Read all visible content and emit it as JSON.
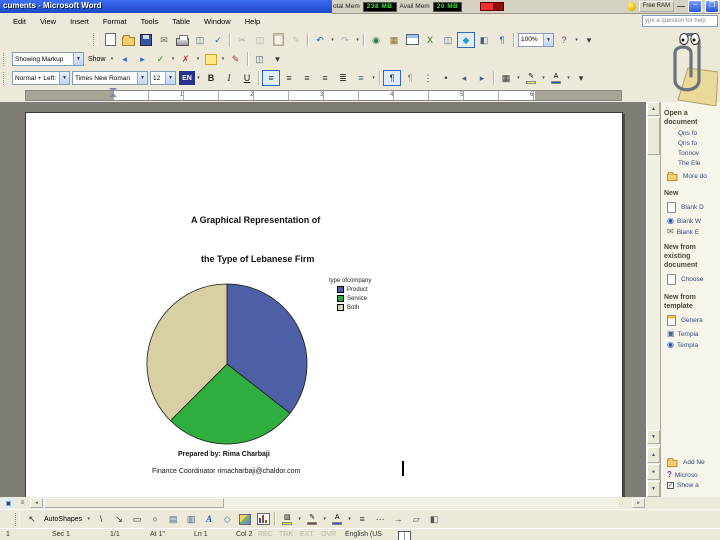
{
  "window": {
    "title_visible": "cuments - Microsoft Word"
  },
  "ram_widget": {
    "total_label": "otal Mem",
    "total_value": "238 MB",
    "avail_label": "Avail Mem",
    "avail_value": "20 MB",
    "free_button": "Free RAM",
    "minimize_glyph": "—"
  },
  "menubar": {
    "items": [
      "Edit",
      "View",
      "Insert",
      "Format",
      "Tools",
      "Table",
      "Window",
      "Help"
    ],
    "ask_box": "ype a question for help"
  },
  "toolbars": {
    "standard": [
      {
        "name": "new-document",
        "shape": "page"
      },
      {
        "name": "open",
        "shape": "folder"
      },
      {
        "name": "save",
        "shape": "disk"
      },
      {
        "name": "mail-recipient",
        "glyph": "✉",
        "color": "#6a6a5a"
      },
      {
        "name": "print",
        "shape": "printer"
      },
      {
        "name": "print-preview",
        "glyph": "◫",
        "color": "#44608c"
      },
      {
        "name": "spelling-grammar",
        "glyph": "✓",
        "color": "#2a62c8"
      },
      {
        "sep": true
      },
      {
        "name": "cut",
        "glyph": "✂",
        "color": "#556",
        "grayed": true
      },
      {
        "name": "copy",
        "glyph": "◫",
        "color": "#556",
        "grayed": true
      },
      {
        "name": "paste",
        "shape": "clipboard",
        "grayed": true
      },
      {
        "name": "format-painter",
        "glyph": "✎",
        "color": "#b08030",
        "grayed": true
      },
      {
        "sep": true
      },
      {
        "name": "undo",
        "glyph": "↶",
        "color": "#2a62c8",
        "dropdown": true
      },
      {
        "name": "redo",
        "glyph": "↷",
        "color": "#2a62c8",
        "grayed": true,
        "dropdown": true
      },
      {
        "sep": true
      },
      {
        "name": "insert-hyperlink",
        "glyph": "◉",
        "color": "#2a7a4a"
      },
      {
        "name": "tables-and-borders",
        "glyph": "▦",
        "color": "#8a6a2a"
      },
      {
        "name": "insert-table",
        "shape": "table"
      },
      {
        "name": "insert-excel-worksheet",
        "glyph": "X",
        "color": "#1a7a2a"
      },
      {
        "name": "columns",
        "glyph": "◫",
        "color": "#44608c"
      },
      {
        "name": "drawing",
        "glyph": "◆",
        "color": "#2a9ac8",
        "pressed": true
      },
      {
        "name": "document-map",
        "glyph": "◧",
        "color": "#44608c"
      },
      {
        "name": "show-hide-paragraph",
        "glyph": "¶",
        "color": "#2a62c8"
      },
      {
        "sep": true
      }
    ],
    "zoom_value": "100%",
    "standard_tail": [
      {
        "name": "help",
        "glyph": "?",
        "color": "#7030a0",
        "dropdown": true
      },
      {
        "name": "toolbar-options",
        "glyph": "▾",
        "color": "#333"
      }
    ],
    "reviewing": {
      "markup_dropdown": "Showing Markup",
      "show_button": "Show",
      "icons": [
        {
          "name": "previous-change",
          "glyph": "◂",
          "color": "#2a62c8"
        },
        {
          "name": "next-change",
          "glyph": "▸",
          "color": "#2a62c8"
        },
        {
          "name": "accept-change",
          "glyph": "✓",
          "color": "#2a8a2a",
          "dropdown": true
        },
        {
          "name": "reject-change",
          "glyph": "✗",
          "color": "#c03030",
          "dropdown": true
        },
        {
          "name": "new-comment",
          "shape": "comment",
          "dropdown": true
        },
        {
          "name": "track-changes",
          "glyph": "✎",
          "color": "#a03030"
        },
        {
          "sep": true
        },
        {
          "name": "reviewing-pane",
          "glyph": "◫",
          "color": "#44608c"
        },
        {
          "name": "toolbar-options",
          "glyph": "▾",
          "color": "#333"
        }
      ]
    },
    "formatting": {
      "style": "Normal + Left:",
      "font": "Times New Roman",
      "size": "12",
      "language": "EN",
      "icons": [
        {
          "name": "bold",
          "glyph": "B",
          "cls": "fw",
          "color": "#222"
        },
        {
          "name": "italic",
          "glyph": "I",
          "cls": "it",
          "color": "#222"
        },
        {
          "name": "underline",
          "glyph": "U",
          "cls": "un",
          "color": "#222"
        },
        {
          "sep": true
        },
        {
          "name": "align-left",
          "glyph": "≡",
          "color": "#333",
          "pressed": true
        },
        {
          "name": "center",
          "glyph": "≡",
          "color": "#333"
        },
        {
          "name": "align-right",
          "glyph": "≡",
          "color": "#333"
        },
        {
          "name": "justify",
          "glyph": "≡",
          "color": "#333"
        },
        {
          "name": "distributed",
          "glyph": "≣",
          "color": "#333"
        },
        {
          "name": "line-spacing",
          "glyph": "≡",
          "color": "#44608c",
          "dropdown": true
        },
        {
          "sep": true
        },
        {
          "name": "left-to-right",
          "glyph": "¶",
          "color": "#333",
          "pressed": true
        },
        {
          "name": "right-to-left",
          "glyph": "¶",
          "color": "#888"
        },
        {
          "name": "numbering",
          "glyph": "⋮",
          "color": "#333"
        },
        {
          "name": "bullets",
          "glyph": "•",
          "color": "#333"
        },
        {
          "name": "decrease-indent",
          "glyph": "◂",
          "color": "#44608c"
        },
        {
          "name": "increase-indent",
          "glyph": "▸",
          "color": "#44608c"
        },
        {
          "sep": true
        },
        {
          "name": "outside-border",
          "glyph": "▦",
          "color": "#333",
          "dropdown": true
        },
        {
          "name": "highlight",
          "glyph": "✎",
          "swatch": "#ffff66",
          "dropdown": true
        },
        {
          "name": "font-color",
          "glyph": "A",
          "swatch": "#2a52c8",
          "dropdown": true
        },
        {
          "name": "toolbar-options",
          "glyph": "▾",
          "color": "#333"
        }
      ]
    }
  },
  "ruler": {
    "numbers": [
      "1",
      "2",
      "3",
      "4",
      "5",
      "6"
    ]
  },
  "document": {
    "title_line1": "A Graphical Representation of",
    "title_line2": "the Type of Lebanese Firm",
    "prepared_line": "Prepared  by:   Rima Charbaji",
    "contact_line": "Finance Coordinator   rimacharbaji@chaldor.com"
  },
  "chart_data": {
    "type": "pie",
    "title": "type ofcompany",
    "slices": [
      {
        "label": "Product",
        "color": "#4e5fa5",
        "angle_deg": 128,
        "pct": 35.5
      },
      {
        "label": "Service",
        "color": "#2fad3e",
        "angle_deg": 97,
        "pct": 27.0
      },
      {
        "label": "Both",
        "color": "#d8d0a2",
        "angle_deg": 135,
        "pct": 37.5
      }
    ],
    "legend_position": "right"
  },
  "task_pane": {
    "sections": [
      {
        "header": "Open a document",
        "items": [
          {
            "label": "Qns fo",
            "icon": "none"
          },
          {
            "label": "Qns fo",
            "icon": "none"
          },
          {
            "label": "Tonnov",
            "icon": "none"
          },
          {
            "label": "The Ele",
            "icon": "none"
          },
          {
            "label": "More do",
            "icon": "folder"
          }
        ]
      },
      {
        "header": "New",
        "items": [
          {
            "label": "Blank D",
            "icon": "page"
          },
          {
            "label": "Blank W",
            "icon": "globe"
          },
          {
            "label": "Blank E",
            "icon": "email"
          }
        ]
      },
      {
        "header": "New from existing document",
        "items": [
          {
            "label": "Choose",
            "icon": "page"
          }
        ]
      },
      {
        "header": "New from template",
        "items": [
          {
            "label": "Genera",
            "icon": "template"
          },
          {
            "label": "Templa",
            "icon": "screen"
          },
          {
            "label": "Templa",
            "icon": "globe"
          }
        ]
      }
    ],
    "footer_items": [
      {
        "label": "Add Ne",
        "icon": "folder"
      },
      {
        "label": "Microso",
        "icon": "help"
      },
      {
        "label": "Show a",
        "icon": "checkbox"
      }
    ]
  },
  "drawing_toolbar": {
    "autoshapes_label": "AutoShapes",
    "select": [
      {
        "name": "select-objects",
        "glyph": "↖",
        "color": "#333"
      }
    ],
    "icons": [
      {
        "name": "line",
        "glyph": "\\",
        "color": "#333"
      },
      {
        "name": "arrow",
        "glyph": "↘",
        "color": "#333"
      },
      {
        "name": "rectangle",
        "glyph": "▭",
        "color": "#333"
      },
      {
        "name": "oval",
        "glyph": "○",
        "color": "#333"
      },
      {
        "name": "text-box",
        "glyph": "▤",
        "color": "#44608c"
      },
      {
        "name": "vertical-text-box",
        "glyph": "▥",
        "color": "#44608c"
      },
      {
        "name": "insert-wordart",
        "glyph": "A",
        "cls": "it fw",
        "color": "#2a52c8"
      },
      {
        "name": "insert-diagram",
        "glyph": "◇",
        "color": "#2a8a8a"
      },
      {
        "name": "insert-clip-art",
        "shape": "clipart"
      },
      {
        "name": "insert-chart",
        "shape": "chart"
      },
      {
        "sep": true
      },
      {
        "name": "fill-color",
        "glyph": "▨",
        "swatch": "#ffff00",
        "dropdown": true
      },
      {
        "name": "line-color",
        "glyph": "✎",
        "swatch": "#803030",
        "dropdown": true
      },
      {
        "name": "font-color-drawing",
        "glyph": "A",
        "swatch": "#2a52c8",
        "dropdown": true
      },
      {
        "name": "line-style",
        "glyph": "≡",
        "color": "#333"
      },
      {
        "name": "dash-style",
        "glyph": "⋯",
        "color": "#333"
      },
      {
        "name": "arrow-style",
        "glyph": "→",
        "color": "#333"
      },
      {
        "name": "shadow-style",
        "glyph": "▱",
        "color": "#556"
      },
      {
        "name": "3d-style",
        "glyph": "◧",
        "color": "#556"
      }
    ]
  },
  "view_buttons": [
    {
      "name": "print-layout-view",
      "glyph": "▣",
      "pressed": true
    },
    {
      "name": "outline-view",
      "glyph": "≡"
    }
  ],
  "status_bar": {
    "segments": [
      "1",
      "Sec 1",
      "1/1",
      "At 1\"",
      "Ln 1",
      "Col 2"
    ],
    "modes": [
      "REC",
      "TRK",
      "EXT",
      "OVR"
    ],
    "language": "English (US"
  }
}
